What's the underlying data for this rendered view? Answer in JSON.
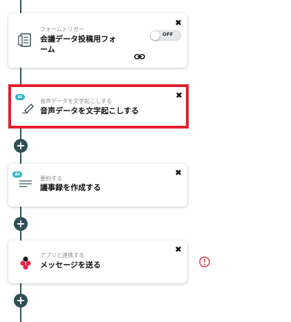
{
  "steps": [
    {
      "subtitle": "フォームトリガー",
      "title": "会議データ投稿用フォーム",
      "icon": "form-icon",
      "toggle_label": "OFF",
      "close": "✖"
    },
    {
      "subtitle": "音声データを文字起こしする",
      "title": "音声データを文字起こしする",
      "icon": "pen-icon",
      "badge": "AI",
      "close": "✖"
    },
    {
      "subtitle": "要約する",
      "title": "議事録を作成する",
      "icon": "lines-icon",
      "badge": "AI",
      "close": "✖"
    },
    {
      "subtitle": "アプリと連携する",
      "title": "メッセージを送る",
      "icon": "app-logo-icon",
      "close": "✖"
    }
  ],
  "add_label": "+",
  "colors": {
    "accent": "#2f4e55",
    "ai_badge": "#31b5c9",
    "selected_border": "#e01f2b",
    "alert": "#e0393e"
  }
}
